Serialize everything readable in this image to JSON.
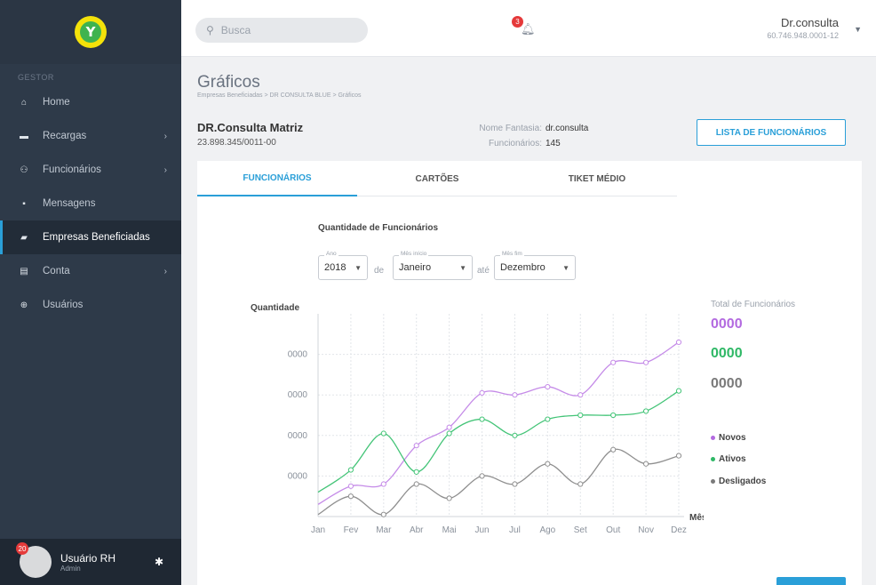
{
  "brand": {
    "logo_letter": "Y"
  },
  "sidebar": {
    "section_label": "GESTOR",
    "items": [
      {
        "label": "Home",
        "icon": "home-icon",
        "glyph": "⌂",
        "chevron": false,
        "active": false
      },
      {
        "label": "Recargas",
        "icon": "card-icon",
        "glyph": "▬",
        "chevron": true,
        "active": false
      },
      {
        "label": "Funcionários",
        "icon": "people-icon",
        "glyph": "⚇",
        "chevron": true,
        "active": false
      },
      {
        "label": "Mensagens",
        "icon": "message-icon",
        "glyph": "▪",
        "chevron": false,
        "active": false
      },
      {
        "label": "Empresas Beneficiadas",
        "icon": "briefcase-icon",
        "glyph": "▰",
        "chevron": false,
        "active": true
      },
      {
        "label": "Conta",
        "icon": "account-icon",
        "glyph": "▤",
        "chevron": true,
        "active": false
      },
      {
        "label": "Usuários",
        "icon": "users-icon",
        "glyph": "⊕",
        "chevron": false,
        "active": false
      }
    ],
    "user": {
      "name": "Usuário RH",
      "role": "Admin",
      "badge": "20"
    }
  },
  "topbar": {
    "search_placeholder": "Busca",
    "notifications_count": "3",
    "account_name": "Dr.consulta",
    "account_cnpj": "60.746.948.0001-12"
  },
  "page": {
    "title": "Gráficos",
    "breadcrumb": "Empresas Beneficiadas > DR CONSULTA BLUE > Gráficos",
    "company_name": "DR.Consulta Matriz",
    "company_cnpj": "23.898.345/0011-00",
    "fantasy_label": "Nome Fantasia:",
    "fantasy_value": "dr.consulta",
    "employees_label": "Funcionários:",
    "employees_value": "145",
    "list_button": "LISTA DE FUNCIONÁRIOS"
  },
  "tabs": [
    "FUNCIONÁRIOS",
    "CARTÕES",
    "TIKET MÉDIO"
  ],
  "chart_section": {
    "title": "Quantidade de Funcionários",
    "year_label": "Ano",
    "year_value": "2018",
    "de": "de",
    "start_label": "Mês início",
    "start_value": "Janeiro",
    "ate": "até",
    "end_label": "Mês fim",
    "end_value": "Dezembro",
    "totals_title": "Total de Funcionários",
    "totals": [
      {
        "value": "0000",
        "color": "#b36ae0"
      },
      {
        "value": "0000",
        "color": "#2fb866"
      },
      {
        "value": "0000",
        "color": "#7a7a7a"
      }
    ],
    "legend": [
      {
        "label": "Novos",
        "color": "#b36ae0"
      },
      {
        "label": "Ativos",
        "color": "#2fb866"
      },
      {
        "label": "Desligados",
        "color": "#7a7a7a"
      }
    ]
  },
  "chart_data": {
    "type": "line",
    "ylabel": "Quantidade",
    "xlabel": "Mês",
    "y_tick_labels": [
      "0000",
      "0000",
      "0000",
      "0000"
    ],
    "categories": [
      "Jan",
      "Fev",
      "Mar",
      "Abr",
      "Mai",
      "Jun",
      "Jul",
      "Ago",
      "Set",
      "Out",
      "Nov",
      "Dez"
    ],
    "ylim": [
      0,
      10
    ],
    "series": [
      {
        "name": "Novos",
        "color": "#c58be8",
        "values": [
          0.6,
          1.5,
          1.6,
          3.5,
          4.4,
          6.1,
          6.0,
          6.4,
          6.0,
          7.6,
          7.6,
          8.6
        ]
      },
      {
        "name": "Ativos",
        "color": "#43c477",
        "values": [
          1.2,
          2.3,
          4.1,
          2.2,
          4.1,
          4.8,
          4.0,
          4.8,
          5.0,
          5.0,
          5.2,
          6.2
        ]
      },
      {
        "name": "Desligados",
        "color": "#8f8f8f",
        "values": [
          0.1,
          1.0,
          0.1,
          1.6,
          0.9,
          2.0,
          1.6,
          2.6,
          1.6,
          3.3,
          2.6,
          3.0
        ]
      }
    ]
  }
}
